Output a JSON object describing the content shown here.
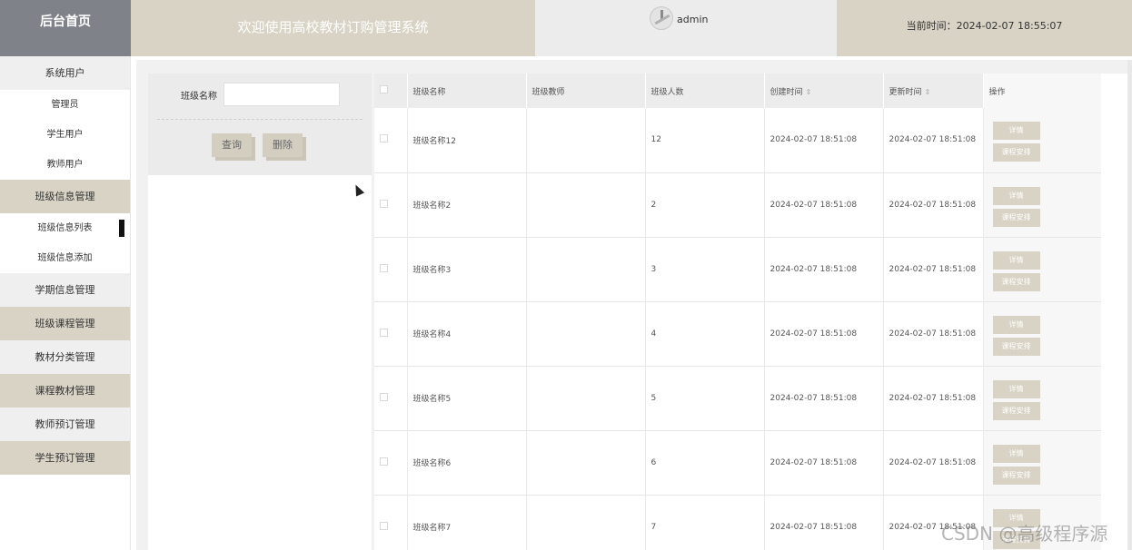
{
  "header": {
    "brand": "后台首页",
    "title": "欢迎使用高校教材订购管理系统",
    "user": "admin",
    "time_label": "当前时间：",
    "time_value": "2024-02-07 18:55:07"
  },
  "sidebar": {
    "groups": [
      {
        "label": "系统用户",
        "items": [
          "管理员",
          "学生用户",
          "教师用户"
        ]
      },
      {
        "label": "班级信息管理",
        "items": [
          "班级信息列表",
          "班级信息添加"
        ]
      },
      {
        "label": "学期信息管理",
        "items": []
      },
      {
        "label": "班级课程管理",
        "items": []
      },
      {
        "label": "教材分类管理",
        "items": []
      },
      {
        "label": "课程教材管理",
        "items": []
      },
      {
        "label": "教师预订管理",
        "items": []
      },
      {
        "label": "学生预订管理",
        "items": []
      }
    ]
  },
  "search": {
    "label": "班级名称",
    "placeholder": "",
    "query_button": "查询",
    "delete_button": "删除"
  },
  "table": {
    "headers": [
      "班级名称",
      "班级教师",
      "班级人数",
      "创建时间",
      "更新时间",
      "操作"
    ],
    "sort_icon": "⇕",
    "rows": [
      {
        "name": "班级名称12",
        "teacher": "",
        "count": "12",
        "created": "2024-02-07 18:51:08",
        "updated": "2024-02-07 18:51:08"
      },
      {
        "name": "班级名称2",
        "teacher": "",
        "count": "2",
        "created": "2024-02-07 18:51:08",
        "updated": "2024-02-07 18:51:08"
      },
      {
        "name": "班级名称3",
        "teacher": "",
        "count": "3",
        "created": "2024-02-07 18:51:08",
        "updated": "2024-02-07 18:51:08"
      },
      {
        "name": "班级名称4",
        "teacher": "",
        "count": "4",
        "created": "2024-02-07 18:51:08",
        "updated": "2024-02-07 18:51:08"
      },
      {
        "name": "班级名称5",
        "teacher": "",
        "count": "5",
        "created": "2024-02-07 18:51:08",
        "updated": "2024-02-07 18:51:08"
      },
      {
        "name": "班级名称6",
        "teacher": "",
        "count": "6",
        "created": "2024-02-07 18:51:08",
        "updated": "2024-02-07 18:51:08"
      },
      {
        "name": "班级名称7",
        "teacher": "",
        "count": "7",
        "created": "2024-02-07 18:51:08",
        "updated": "2024-02-07 18:51:08"
      }
    ],
    "detail_button": "详情",
    "schedule_button": "课程安排"
  },
  "watermark": "CSDN @高级程序源",
  "colors": {
    "accent": "#d8d3c4",
    "brand_bg": "#7f8288",
    "panel_bg": "#ebebeb"
  }
}
